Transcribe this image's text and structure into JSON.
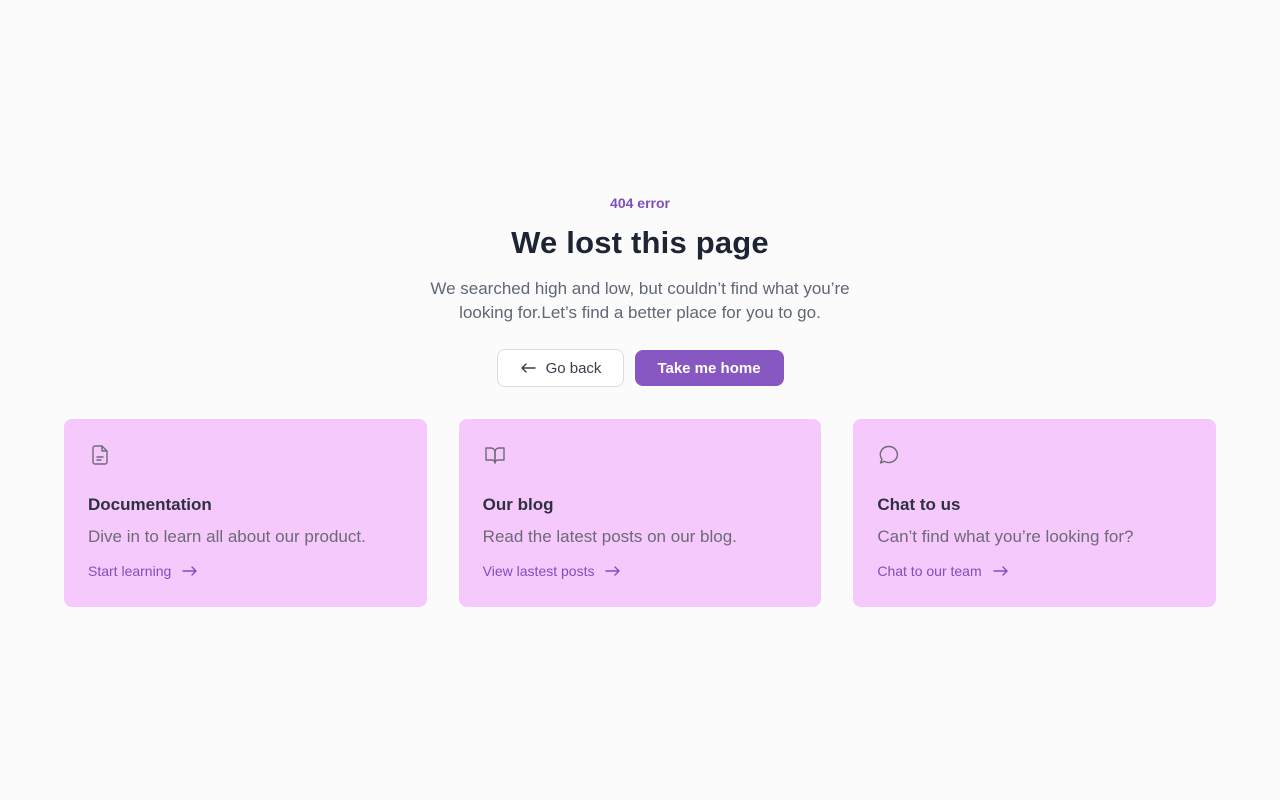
{
  "hero": {
    "eyebrow": "404 error",
    "title": "We lost this page",
    "subtitle": "We searched high and low, but couldn’t find what you’re looking for.Let’s find a better place for you to go."
  },
  "actions": {
    "back_label": "Go back",
    "home_label": "Take me home"
  },
  "cards": [
    {
      "icon": "document-icon",
      "title": "Documentation",
      "description": "Dive in to learn all about our product.",
      "link": "Start learning"
    },
    {
      "icon": "book-icon",
      "title": "Our blog",
      "description": "Read the latest posts on our blog.",
      "link": "View lastest posts"
    },
    {
      "icon": "chat-bubble-icon",
      "title": "Chat to us",
      "description": "Can’t find what you’re looking for?",
      "link": "Chat to our team"
    }
  ],
  "colors": {
    "accent": "#8757c2",
    "card_background": "#f6c9fd",
    "page_background": "#fbfbfb",
    "heading": "#1d2433"
  }
}
